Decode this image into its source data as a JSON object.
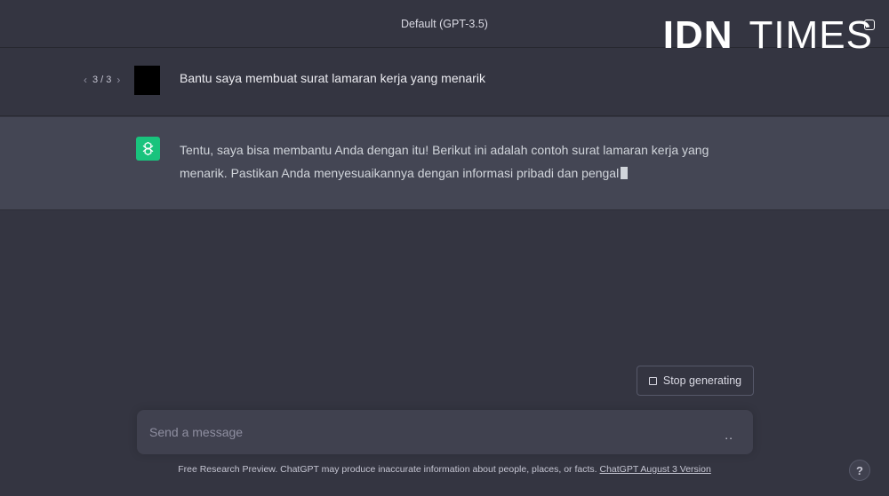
{
  "header": {
    "model_title": "Default (GPT-3.5)"
  },
  "watermark": {
    "part1": "IDN",
    "part2": "TIMES"
  },
  "conversation": {
    "user": {
      "pager_text": "3 / 3",
      "message": "Bantu saya membuat surat lamaran kerja yang menarik"
    },
    "assistant": {
      "message": "Tentu, saya bisa membantu Anda dengan itu! Berikut ini adalah contoh surat lamaran kerja yang menarik. Pastikan Anda menyesuaikannya dengan informasi pribadi dan pengal"
    }
  },
  "controls": {
    "stop_label": "Stop generating",
    "composer_placeholder": "Send a message",
    "composer_dots": ".."
  },
  "footer": {
    "text": "Free Research Preview. ChatGPT may produce inaccurate information about people, places, or facts.",
    "link": "ChatGPT August 3 Version"
  },
  "help": {
    "label": "?"
  },
  "colors": {
    "background": "#343541",
    "assistant_bg": "#444654",
    "gpt_accent": "#19c37d"
  },
  "icons": {
    "pager_prev": "chevron-left-icon",
    "pager_next": "chevron-right-icon",
    "assistant": "openai-logo-icon",
    "stop": "stop-square-icon"
  }
}
